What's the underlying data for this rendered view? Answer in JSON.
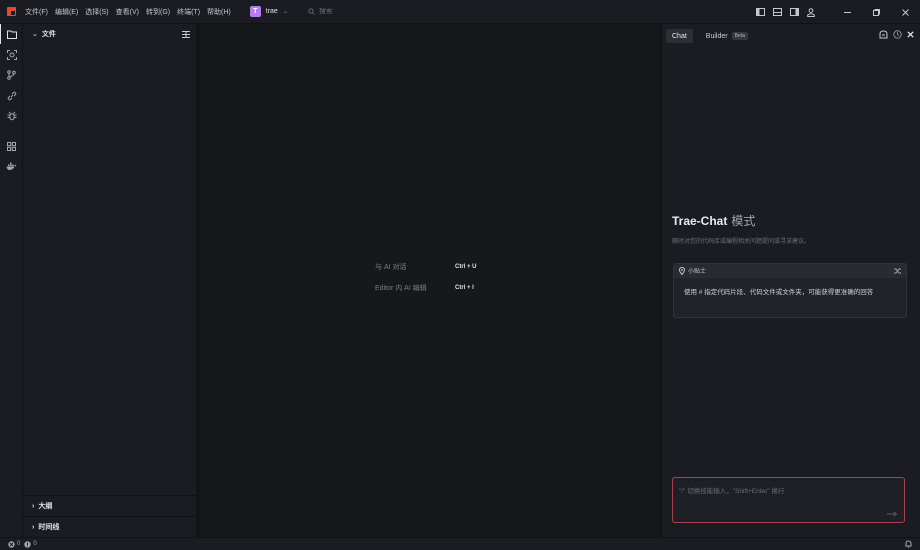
{
  "titlebar": {
    "menus": [
      "文件(F)",
      "编辑(E)",
      "选择(S)",
      "查看(V)",
      "转到(G)",
      "终端(T)",
      "帮助(H)"
    ],
    "project_initial": "T",
    "project_name": "trae",
    "search_placeholder": "搜索"
  },
  "explorer": {
    "files_title": "文件",
    "outline_title": "大纲",
    "timeline_title": "时间线"
  },
  "editor": {
    "shortcuts": [
      {
        "label": "与 AI 对话",
        "key": "Ctrl + U"
      },
      {
        "label": "Editor 内 AI 编辑",
        "key": "Ctrl + I"
      }
    ]
  },
  "chat": {
    "tab_chat": "Chat",
    "tab_builder": "Builder",
    "beta_badge": "Beta",
    "title": "Trae-Chat",
    "title_mode": "模式",
    "subtitle": "随时对您的代码库或编程相关问题提问或寻求建议。",
    "tips_title": "小贴士",
    "tips_body": "使用 # 指定代码片段、代码文件或文件夹，可能获得更准确的回答",
    "input_placeholder": "\"/\" 切换技能输入，\"Shift+Enter\" 换行"
  },
  "status": {
    "errors": "0",
    "warnings": "0"
  },
  "colors": {
    "accent_logo": "#e5473a",
    "project_avatar": "#b57cf2",
    "input_border": "#a8414b"
  }
}
